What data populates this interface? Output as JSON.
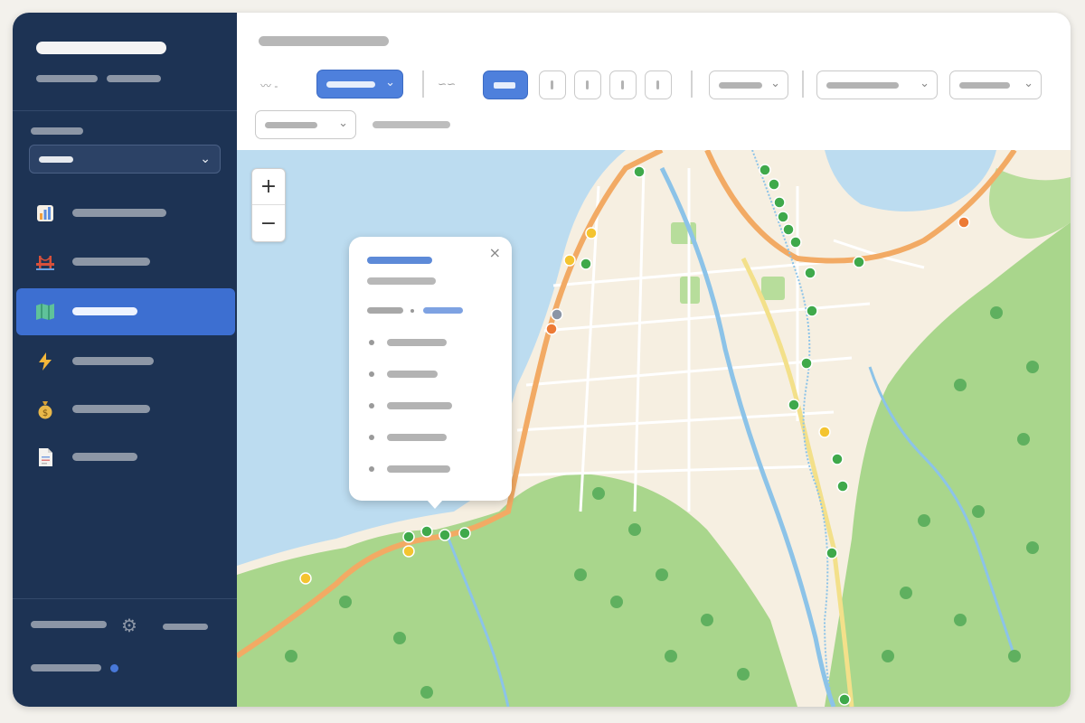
{
  "window": {
    "title": ""
  },
  "sidebar": {
    "brand": {
      "title": "",
      "subtitle": ""
    },
    "section_label": "",
    "selector": {
      "value": ""
    },
    "items": [
      {
        "label": "",
        "icon": "bar-chart-icon",
        "active": false
      },
      {
        "label": "",
        "icon": "bridge-icon",
        "active": false
      },
      {
        "label": "",
        "icon": "map-icon",
        "active": true
      },
      {
        "label": "",
        "icon": "lightning-icon",
        "active": false
      },
      {
        "label": "",
        "icon": "money-bag-icon",
        "active": false
      },
      {
        "label": "",
        "icon": "document-icon",
        "active": false
      }
    ],
    "footer": {
      "user": "",
      "link": "",
      "status": ""
    }
  },
  "toolbar": {
    "title": "",
    "filter_primary": {
      "value": ""
    },
    "pager": {
      "selected": 1,
      "count": 5
    },
    "filter_2": {
      "value": ""
    },
    "filter_3": {
      "value": ""
    },
    "filter_4": {
      "value": ""
    },
    "filter_5": {
      "value": ""
    },
    "meta": ""
  },
  "map": {
    "zoom_in_label": "+",
    "zoom_out_label": "−",
    "popup": {
      "close_label": "×",
      "title": "",
      "subtitle": "",
      "meta": [
        "",
        ""
      ],
      "items": [
        "",
        "",
        "",
        "",
        ""
      ]
    },
    "colors": {
      "water": "#bcdcf0",
      "land": "#f6efe1",
      "forest": "#a9d68c",
      "road_primary": "#f2aa64",
      "rail": "#f3e08a",
      "stop_green": "#3fa94b",
      "stop_yellow": "#f4c430",
      "stop_orange": "#ec7a35",
      "stop_grey": "#8b95a6"
    }
  }
}
